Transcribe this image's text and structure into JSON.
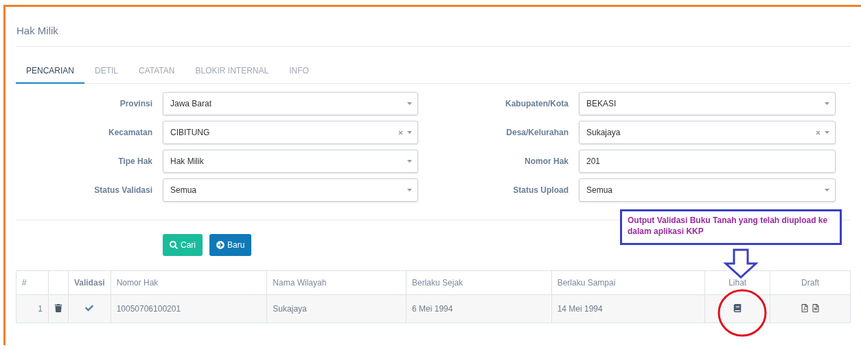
{
  "page_title": "Hak Milik",
  "tabs": [
    {
      "label": "PENCARIAN",
      "selected": true
    },
    {
      "label": "DETIL",
      "selected": false
    },
    {
      "label": "CATATAN",
      "selected": false
    },
    {
      "label": "BLOKIR INTERNAL",
      "selected": false
    },
    {
      "label": "INFO",
      "selected": false
    }
  ],
  "form": {
    "rows": [
      [
        {
          "label": "Provinsi",
          "value": "Jawa Barat",
          "kind": "select",
          "clearable": false
        },
        {
          "label": "Kabupaten/Kota",
          "value": "BEKASI",
          "kind": "select",
          "clearable": false
        }
      ],
      [
        {
          "label": "Kecamatan",
          "value": "CIBITUNG",
          "kind": "select",
          "clearable": true
        },
        {
          "label": "Desa/Kelurahan",
          "value": "Sukajaya",
          "kind": "select",
          "clearable": true
        }
      ],
      [
        {
          "label": "Tipe Hak",
          "value": "Hak Milik",
          "kind": "select",
          "clearable": false
        },
        {
          "label": "Nomor Hak",
          "value": "201",
          "kind": "text",
          "clearable": false
        }
      ],
      [
        {
          "label": "Status Validasi",
          "value": "Semua",
          "kind": "select",
          "clearable": false
        },
        {
          "label": "Status Upload",
          "value": "Semua",
          "kind": "select",
          "clearable": false
        }
      ]
    ]
  },
  "buttons": [
    {
      "label": "Cari",
      "kind": "search"
    },
    {
      "label": "Baru",
      "kind": "new"
    }
  ],
  "table": {
    "columns": [
      "#",
      "Validasi",
      "Nomor Hak",
      "Nama Wilayah",
      "Berlaku Sejak",
      "Berlaku Sampai",
      "Lihat",
      "Draft"
    ],
    "rows": [
      {
        "number": "1",
        "validated": true,
        "nomor_hak": "10050706100201",
        "nama_wilayah": "Sukajaya",
        "berlaku_sejak": "6 Mei 1994",
        "berlaku_sampai": "14 Mei 1994"
      }
    ]
  },
  "annotation": {
    "text": "Output Validasi Buku Tanah yang telah diupload ke dalam aplikasi KKP"
  }
}
